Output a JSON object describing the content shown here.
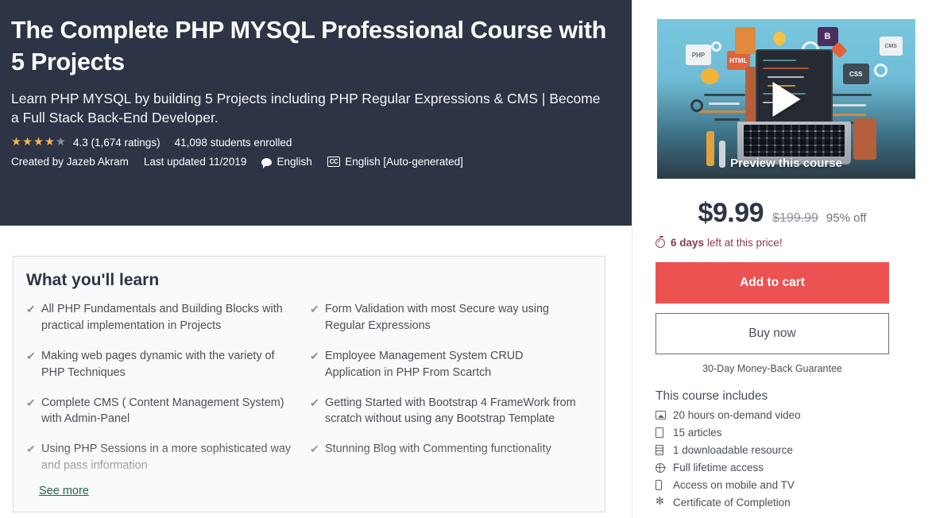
{
  "hero": {
    "title": "The Complete PHP MYSQL Professional Course with 5 Projects",
    "subtitle": "Learn PHP MYSQL by building 5 Projects including PHP Regular Expressions & CMS | Become a Full Stack Back-End Developer.",
    "rating_value": "4.3 (1,674 ratings)",
    "students_enrolled": "41,098 students enrolled",
    "created_by": "Created by Jazeb Akram",
    "last_updated": "Last updated 11/2019",
    "language": "English",
    "captions": "English [Auto-generated]",
    "stars_filled": 4,
    "stars_total": 5,
    "bg_color": "#2d3445"
  },
  "learn": {
    "title": "What you'll learn",
    "see_more": "See more",
    "column_left": [
      "All PHP Fundamentals and Building Blocks with practical implementation in Projects",
      "Making web pages dynamic with the variety of PHP Techniques",
      "Complete CMS ( Content Management System) with Admin-Panel",
      "Using PHP Sessions in a more sophisticated way and pass information"
    ],
    "column_right": [
      "Form Validation with most Secure way using Regular Expressions",
      "Employee Management System CRUD Application in PHP From Scartch",
      "Getting Started with Bootstrap 4 FrameWork from scratch without using any Bootstrap Template",
      "Stunning Blog with Commenting functionality"
    ]
  },
  "sidebar": {
    "preview_label": "Preview this course",
    "price_current": "$9.99",
    "price_original": "$199.99",
    "price_discount": "95% off",
    "timer_strong": "6 days",
    "timer_rest": "left at this price!",
    "add_to_cart": "Add to cart",
    "buy_now": "Buy now",
    "guarantee": "30-Day Money-Back Guarantee",
    "includes_title": "This course includes",
    "accent_red": "#ec5252",
    "includes": [
      {
        "icon": "video-icon",
        "label": "20 hours on-demand video"
      },
      {
        "icon": "article-page-icon",
        "label": "15 articles"
      },
      {
        "icon": "downloadable-resource-icon",
        "label": "1 downloadable resource"
      },
      {
        "icon": "globe-icon",
        "label": "Full lifetime access"
      },
      {
        "icon": "mobile-icon",
        "label": "Access on mobile and TV"
      },
      {
        "icon": "certificate-icon",
        "label": "Certificate of Completion"
      }
    ]
  }
}
